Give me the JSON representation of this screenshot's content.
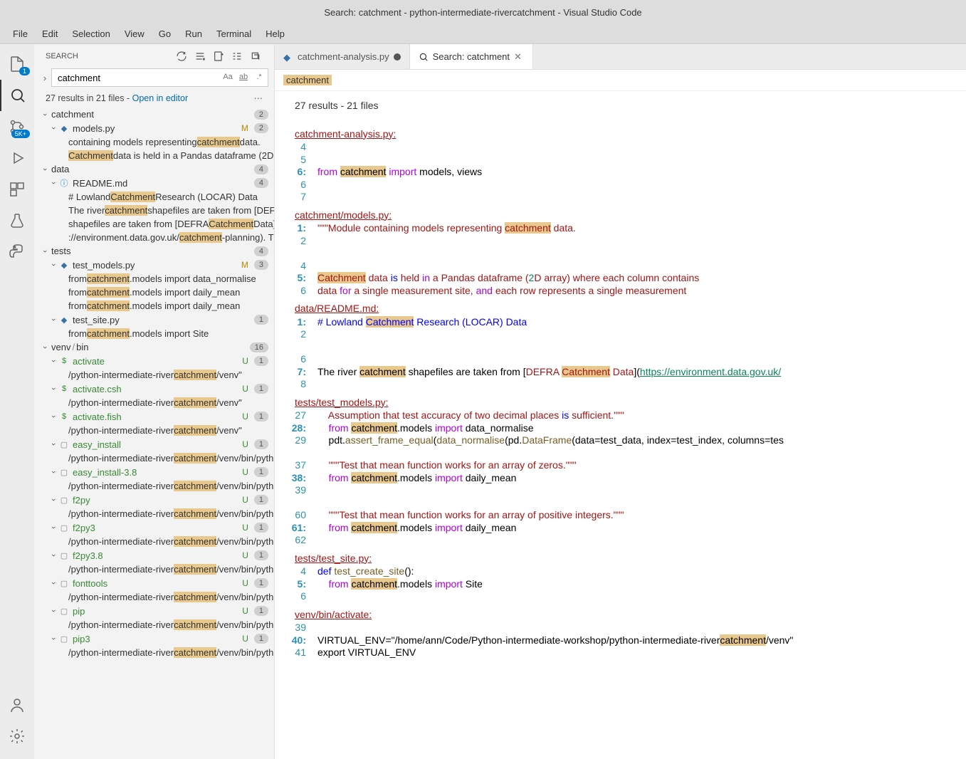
{
  "title": "Search: catchment - python-intermediate-rivercatchment - Visual Studio Code",
  "menu": [
    "File",
    "Edit",
    "Selection",
    "View",
    "Go",
    "Run",
    "Terminal",
    "Help"
  ],
  "activity": {
    "explorer_badge": "1",
    "scm_badge": "5K+"
  },
  "sidebar": {
    "title": "SEARCH",
    "search_value": "catchment",
    "result_summary": "27 results in 21 files - ",
    "open_in_editor": "Open in editor",
    "folders": [
      {
        "label": "catchment",
        "count": "2"
      },
      {
        "label": "data",
        "count": "4"
      },
      {
        "label": "tests",
        "count": "4"
      }
    ],
    "venv_folder_a": "venv",
    "venv_folder_b": "bin",
    "venv_count": "16",
    "files": {
      "models": {
        "name": "models.py",
        "status": "M",
        "count": "2"
      },
      "readme": {
        "name": "README.md",
        "count": "4"
      },
      "test_models": {
        "name": "test_models.py",
        "status": "M",
        "count": "3"
      },
      "test_site": {
        "name": "test_site.py",
        "count": "1"
      },
      "activate": {
        "name": "activate",
        "status": "U",
        "count": "1"
      },
      "activate_csh": {
        "name": "activate.csh",
        "status": "U",
        "count": "1"
      },
      "activate_fish": {
        "name": "activate.fish",
        "status": "U",
        "count": "1"
      },
      "easy_install": {
        "name": "easy_install",
        "status": "U",
        "count": "1"
      },
      "easy_install38": {
        "name": "easy_install-3.8",
        "status": "U",
        "count": "1"
      },
      "f2py": {
        "name": "f2py",
        "status": "U",
        "count": "1"
      },
      "f2py3": {
        "name": "f2py3",
        "status": "U",
        "count": "1"
      },
      "f2py38": {
        "name": "f2py3.8",
        "status": "U",
        "count": "1"
      },
      "fonttools": {
        "name": "fonttools",
        "status": "U",
        "count": "1"
      },
      "pip": {
        "name": "pip",
        "status": "U",
        "count": "1"
      },
      "pip3": {
        "name": "pip3",
        "status": "U",
        "count": "1"
      }
    }
  },
  "tabs": {
    "t1": "catchment-analysis.py",
    "t2": "Search: catchment"
  },
  "breadcrumb": "catchment",
  "editor": {
    "results_header": "27 results - 21 files",
    "file1": "catchment-analysis.py:",
    "file2": "catchment/models.py:",
    "file3": "data/README.md:",
    "file4": "tests/test_models.py:",
    "file5": "tests/test_site.py:",
    "file6": "venv/bin/activate:"
  }
}
